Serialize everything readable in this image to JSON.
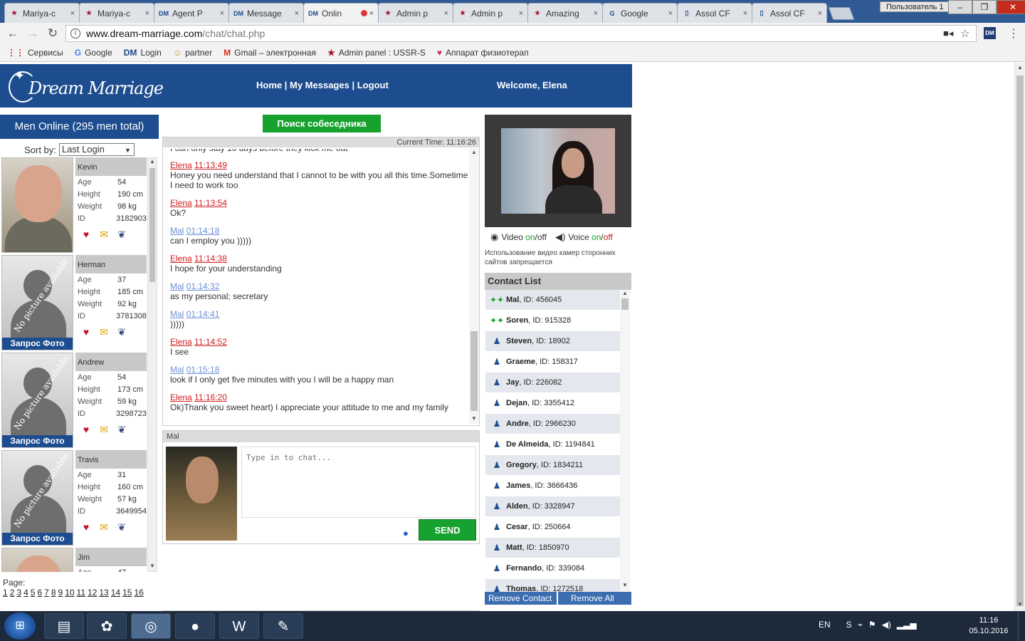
{
  "browser": {
    "tabs": [
      {
        "title": "Mariya-c",
        "icon": "star-favicon"
      },
      {
        "title": "Mariya-c",
        "icon": "star-favicon"
      },
      {
        "title": "Agent P",
        "icon": "dm-favicon"
      },
      {
        "title": "Message",
        "icon": "dm-favicon"
      },
      {
        "title": "Onlin",
        "icon": "dm-favicon",
        "active": true
      },
      {
        "title": "Admin p",
        "icon": "star-favicon"
      },
      {
        "title": "Admin p",
        "icon": "star-favicon"
      },
      {
        "title": "Amazing",
        "icon": "star-favicon"
      },
      {
        "title": "Google",
        "icon": "google-favicon"
      },
      {
        "title": "Assol CF",
        "icon": "doc-favicon"
      },
      {
        "title": "Assol CF",
        "icon": "doc-favicon"
      }
    ],
    "tab_close": "×",
    "user_profile": "Пользователь 1",
    "win_min": "–",
    "win_max": "❐",
    "win_close": "✕",
    "url_host": "www.dream-marriage.com",
    "url_path": "/chat/chat.php",
    "ext_label": "DM",
    "bookmarks": [
      {
        "icon": "apps-icon",
        "glyph": "⋮⋮",
        "label": "Сервисы"
      },
      {
        "icon": "google-icon",
        "glyph": "G",
        "label": "Google"
      },
      {
        "icon": "dm-icon",
        "glyph": "DM",
        "label": "Login"
      },
      {
        "icon": "partner-icon",
        "glyph": "☺",
        "label": "partner"
      },
      {
        "icon": "gmail-icon",
        "glyph": "M",
        "label": "Gmail – электронная"
      },
      {
        "icon": "star-icon",
        "glyph": "★",
        "label": "Admin panel : USSR-S"
      },
      {
        "icon": "heart-icon",
        "glyph": "♥",
        "label": "Аппарат физиотерап"
      }
    ]
  },
  "site": {
    "logo_text": "DREAM MARRIAGE",
    "logo_dream": "Dream",
    "logo_marriage": "Marriage",
    "nav_home": "Home",
    "nav_messages": "My Messages",
    "nav_logout": "Logout",
    "nav_sep": "|",
    "welcome": "Welcome, Elena"
  },
  "men_online": {
    "header": "Men Online (295 men total)",
    "sort_label": "Sort by:",
    "sort_value": "Last Login",
    "labels": {
      "age": "Age",
      "height": "Height",
      "weight": "Weight",
      "id": "ID"
    },
    "request_photo": "Запрос Фото",
    "no_picture": "No picture available",
    "men": [
      {
        "name": "Kevin",
        "age": "54",
        "height": "190 cm",
        "weight": "98 kg",
        "id": "3182903",
        "photo": true
      },
      {
        "name": "Herman",
        "age": "37",
        "height": "185 cm",
        "weight": "92 kg",
        "id": "3781308",
        "photo": false
      },
      {
        "name": "Andrew",
        "age": "54",
        "height": "173 cm",
        "weight": "59 kg",
        "id": "3298723",
        "photo": false
      },
      {
        "name": "Travis",
        "age": "31",
        "height": "160 cm",
        "weight": "57 kg",
        "id": "3649954",
        "photo": false
      },
      {
        "name": "Jim",
        "age": "47",
        "height": "",
        "weight": "",
        "id": "",
        "photo": true
      }
    ],
    "page_label": "Page:",
    "pages": [
      "1",
      "2",
      "3",
      "4",
      "5",
      "6",
      "7",
      "8",
      "9",
      "10",
      "11",
      "12",
      "13",
      "14",
      "15",
      "16"
    ]
  },
  "chat": {
    "search_button": "Поиск собеседника",
    "current_time_label": "Current Time: 11:16:26",
    "cut_line": "I can only stay 10 days before they kick me out",
    "messages": [
      {
        "who": "Elena",
        "time": "11:13:49",
        "side": "el",
        "text": "Honey you need understand that I cannot to be with you all this time.Sometime I need to work too"
      },
      {
        "who": "Elena",
        "time": "11:13:54",
        "side": "el",
        "text": "Ok?"
      },
      {
        "who": "Mal",
        "time": "01:14:18",
        "side": "ma",
        "text": "can I employ you )))))"
      },
      {
        "who": "Elena",
        "time": "11:14:38",
        "side": "el",
        "text": "I hope for your understanding"
      },
      {
        "who": "Mal",
        "time": "01:14:32",
        "side": "ma",
        "text": "as my personal; secretary"
      },
      {
        "who": "Mal",
        "time": "01:14:41",
        "side": "ma",
        "text": ")))))"
      },
      {
        "who": "Elena",
        "time": "11:14:52",
        "side": "el",
        "text": "I see"
      },
      {
        "who": "Mal",
        "time": "01:15:18",
        "side": "ma",
        "text": "look if I only get five minutes with you I will be a happy man"
      },
      {
        "who": "Elena",
        "time": "11:16:20",
        "side": "el",
        "text": "Ok)Thank you sweet heart) I appreciate your attitude to me and my family"
      }
    ],
    "partner_label": "Mal",
    "input_placeholder": "Type in to chat...",
    "send_label": "SEND",
    "smileys": [
      "☺",
      "☻",
      "☺",
      "☹",
      "☺",
      "☻",
      "☺",
      "☹",
      "☺",
      "☻",
      "☺",
      "♥",
      "☺",
      "✦",
      "☻",
      "☺",
      "☻",
      "☺",
      "☹",
      "☺",
      "☻",
      "☺",
      "✿",
      "☺",
      "☻",
      "☺",
      "☹",
      "☺",
      "★",
      "☻",
      "☺",
      "☺",
      "☻",
      "☺"
    ]
  },
  "right": {
    "video_label": "Video",
    "voice_label": "Voice",
    "on": "on",
    "off": "off",
    "slash": "/",
    "cam_warning": "Использование видео камер сторонних сайтов запрещается",
    "contact_header": "Contact List",
    "contacts": [
      {
        "name": "Mal",
        "id": "ID: 456045",
        "online": true
      },
      {
        "name": "Soren ",
        "id": "ID: 915328",
        "online": true
      },
      {
        "name": "Steven",
        "id": "ID: 18902",
        "online": false
      },
      {
        "name": "Graeme",
        "id": "ID: 158317",
        "online": false
      },
      {
        "name": "Jay",
        "id": "ID: 226082",
        "online": false
      },
      {
        "name": "Dejan",
        "id": "ID: 3355412",
        "online": false
      },
      {
        "name": "Andre",
        "id": "ID: 2966230",
        "online": false
      },
      {
        "name": "De Almeida",
        "id": "ID: 1194841",
        "online": false
      },
      {
        "name": "Gregory",
        "id": "ID: 1834211",
        "online": false
      },
      {
        "name": "James",
        "id": "ID: 3666436",
        "online": false
      },
      {
        "name": "Alden",
        "id": "ID: 3328947",
        "online": false
      },
      {
        "name": "Cesar",
        "id": "ID: 250664",
        "online": false
      },
      {
        "name": "Matt",
        "id": "ID: 1850970",
        "online": false
      },
      {
        "name": "Fernando",
        "id": "ID: 339084",
        "online": false
      },
      {
        "name": "Thomas",
        "id": "ID: 1272518",
        "online": false
      }
    ],
    "remove_contact": "Remove Contact",
    "remove_all": "Remove All"
  },
  "taskbar": {
    "lang": "EN",
    "time": "11:16",
    "date": "05.10.2016"
  }
}
